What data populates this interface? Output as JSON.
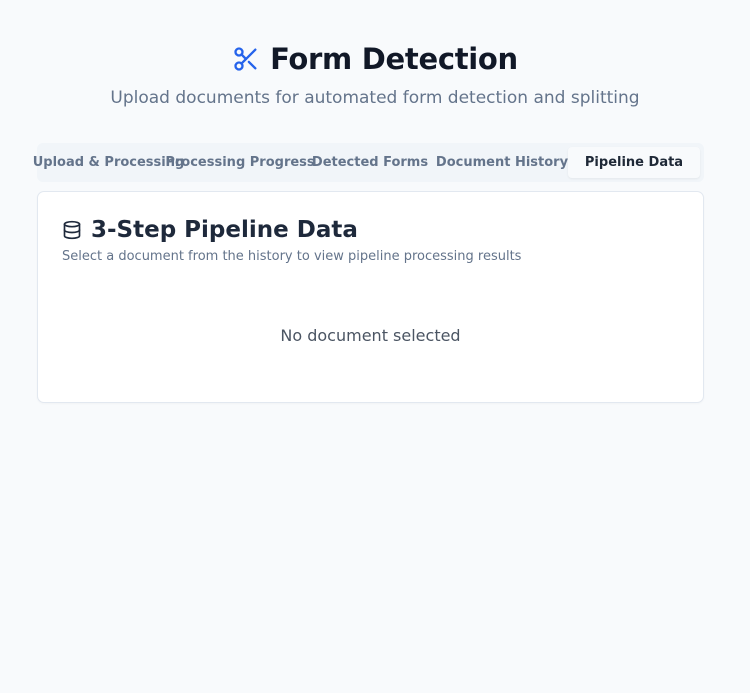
{
  "header": {
    "title": "Form Detection",
    "subtitle": "Upload documents for automated form detection and splitting",
    "icon": "scissors-icon",
    "accent_color": "#2563eb"
  },
  "tabs": [
    {
      "label": "Upload & Processing",
      "active": false
    },
    {
      "label": "Processing Progress",
      "active": false
    },
    {
      "label": "Detected Forms",
      "active": false
    },
    {
      "label": "Document History",
      "active": false
    },
    {
      "label": "Pipeline Data",
      "active": true
    }
  ],
  "card": {
    "icon": "database-icon",
    "title": "3-Step Pipeline Data",
    "description": "Select a document from the history to view pipeline processing results",
    "empty_message": "No document selected"
  }
}
